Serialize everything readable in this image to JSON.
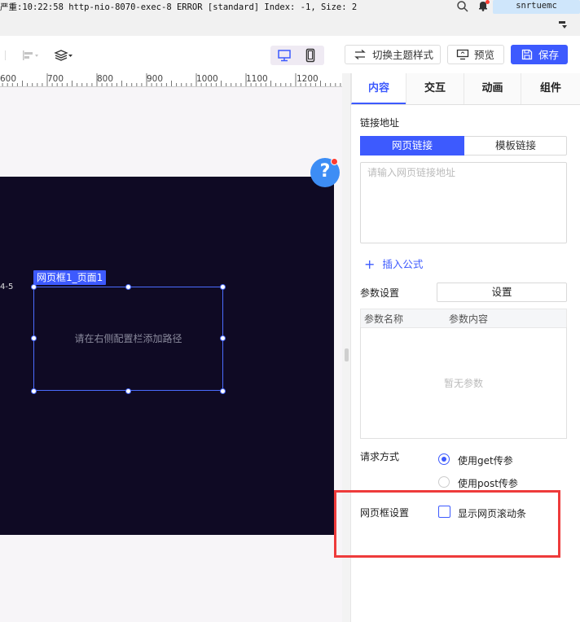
{
  "topbar": {
    "log": "严重:10:22:58 http-nio-8070-exec-8 ERROR [standard] Index: -1, Size: 2",
    "user": "snrtuemc"
  },
  "toolbar": {
    "theme_label": "切换主题样式",
    "preview_label": "预览",
    "save_label": "保存",
    "accent": "#3d5afe"
  },
  "ruler": {
    "ticks": [
      "600",
      "700",
      "800",
      "900",
      "1000",
      "1100",
      "1200"
    ]
  },
  "canvas": {
    "side_label": "4-5",
    "frame_tag": "网页框1_页面1",
    "frame_hint": "请在右侧配置栏添加路径",
    "help": "?"
  },
  "panel": {
    "tabs": [
      "内容",
      "交互",
      "动画",
      "组件"
    ],
    "active_tab": "内容",
    "link_label": "链接地址",
    "seg_web": "网页链接",
    "seg_template": "模板链接",
    "url_placeholder": "请输入网页链接地址",
    "insert_formula": "插入公式",
    "params_label": "参数设置",
    "set_button": "设置",
    "param_col_name": "参数名称",
    "param_col_content": "参数内容",
    "param_empty": "暂无参数",
    "request_label": "请求方式",
    "method_get": "使用get传参",
    "method_post": "使用post传参",
    "frame_settings_label": "网页框设置",
    "show_scrollbar": "显示网页滚动条"
  }
}
